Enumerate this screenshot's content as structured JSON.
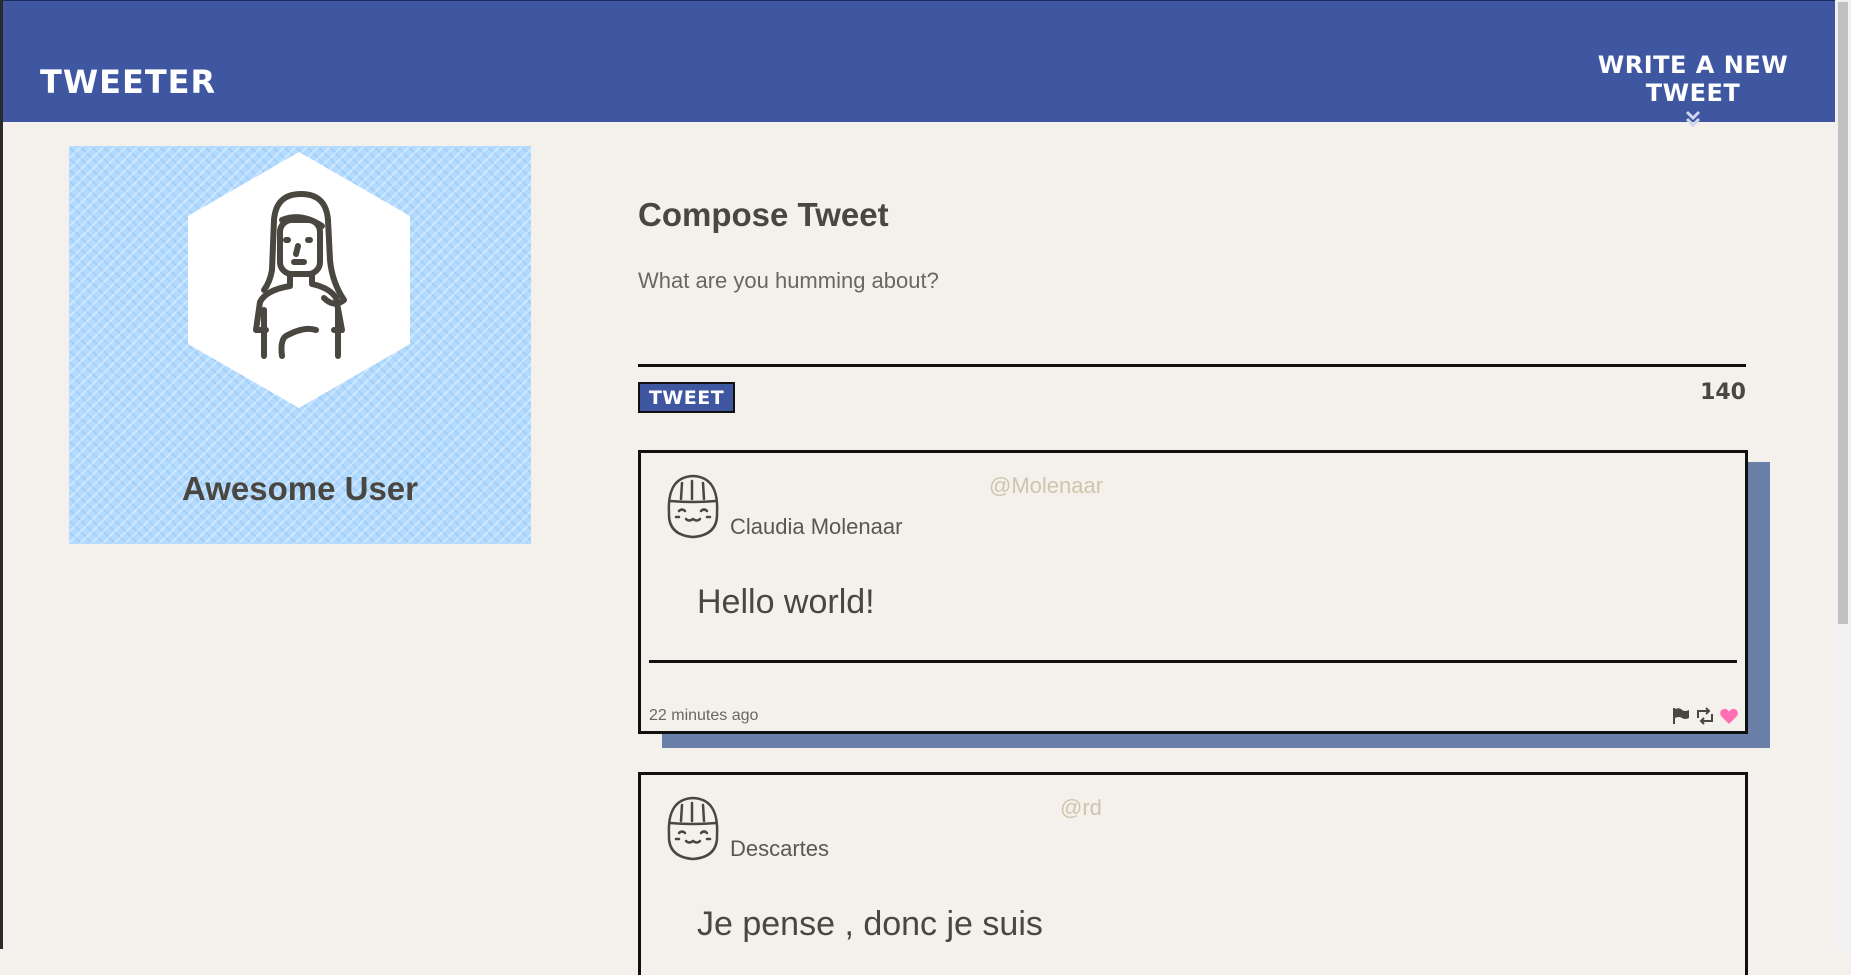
{
  "nav": {
    "brand": "Tweeter",
    "compose_toggle": "Write a new tweet",
    "compose_toggle_icon": "double-chevron-down-icon"
  },
  "profile": {
    "name": "Awesome User",
    "avatar_icon": "user-avatar-icon",
    "background_color": "#b3dbff"
  },
  "compose": {
    "title": "Compose Tweet",
    "placeholder": "What are you humming about?",
    "button_label": "Tweet",
    "counter": "140"
  },
  "tweets": [
    {
      "handle": "@Molenaar",
      "name": "Claudia Molenaar",
      "text": "Hello world!",
      "time": "22 minutes ago",
      "actions": [
        "flag-icon",
        "retweet-icon",
        "heart-icon"
      ]
    },
    {
      "handle": "@rd",
      "name": "Descartes",
      "text": "Je pense , donc je suis"
    }
  ],
  "colors": {
    "nav": "#3f56a1",
    "page_background": "#f4f1ec",
    "text": "#4a4640",
    "handle": "#cdc6ad",
    "tweet_shadow": "#6a7fa8",
    "heart": "#ff6fb5"
  }
}
